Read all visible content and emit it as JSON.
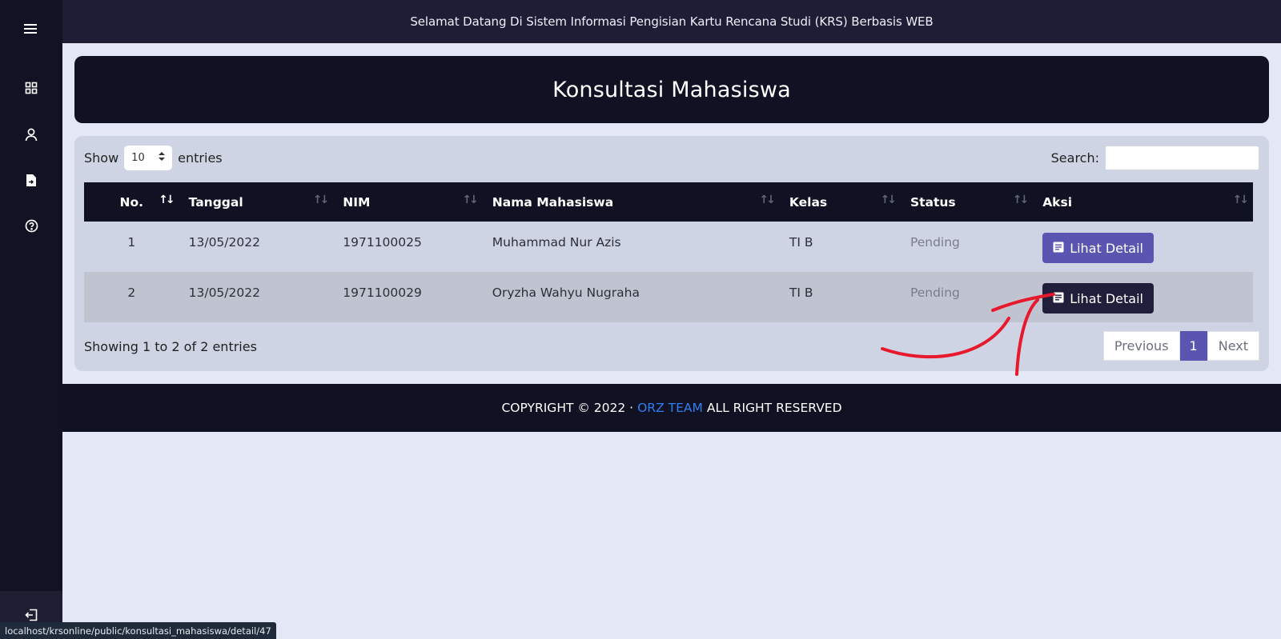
{
  "sidebar": {
    "icons": [
      "menu-icon",
      "dashboard-icon",
      "user-icon",
      "document-icon",
      "help-icon",
      "logout-icon"
    ]
  },
  "topbar": {
    "title": "Selamat Datang Di Sistem Informasi Pengisian Kartu Rencana Studi (KRS) Berbasis WEB"
  },
  "page": {
    "title": "Konsultasi Mahasiswa"
  },
  "table_controls": {
    "show_label": "Show",
    "entries_value": "10",
    "entries_label": "entries",
    "search_label": "Search:",
    "search_value": ""
  },
  "table": {
    "columns": [
      "No.",
      "Tanggal",
      "NIM",
      "Nama Mahasiswa",
      "Kelas",
      "Status",
      "Aksi"
    ],
    "rows": [
      {
        "no": "1",
        "tanggal": "13/05/2022",
        "nim": "1971100025",
        "nama": "Muhammad Nur Azis",
        "kelas": "TI B",
        "status": "Pending",
        "aksi": "Lihat Detail"
      },
      {
        "no": "2",
        "tanggal": "13/05/2022",
        "nim": "1971100029",
        "nama": "Oryzha Wahyu Nugraha",
        "kelas": "TI B",
        "status": "Pending",
        "aksi": "Lihat Detail"
      }
    ],
    "info": "Showing 1 to 2 of 2 entries",
    "pagination": {
      "previous": "Previous",
      "current": "1",
      "next": "Next"
    }
  },
  "footer": {
    "prefix": "COPYRIGHT © 2022 ·",
    "team": "ORZ TEAM",
    "suffix": "ALL RIGHT RESERVED"
  },
  "status_url": "localhost/krsonline/public/konsultasi_mahasiswa/detail/47",
  "colors": {
    "sidebar": "#111223",
    "topbar": "#1f1d35",
    "accent": "#5a55b0",
    "footer_link": "#2f7ff3",
    "annotation": "#e8192c"
  }
}
